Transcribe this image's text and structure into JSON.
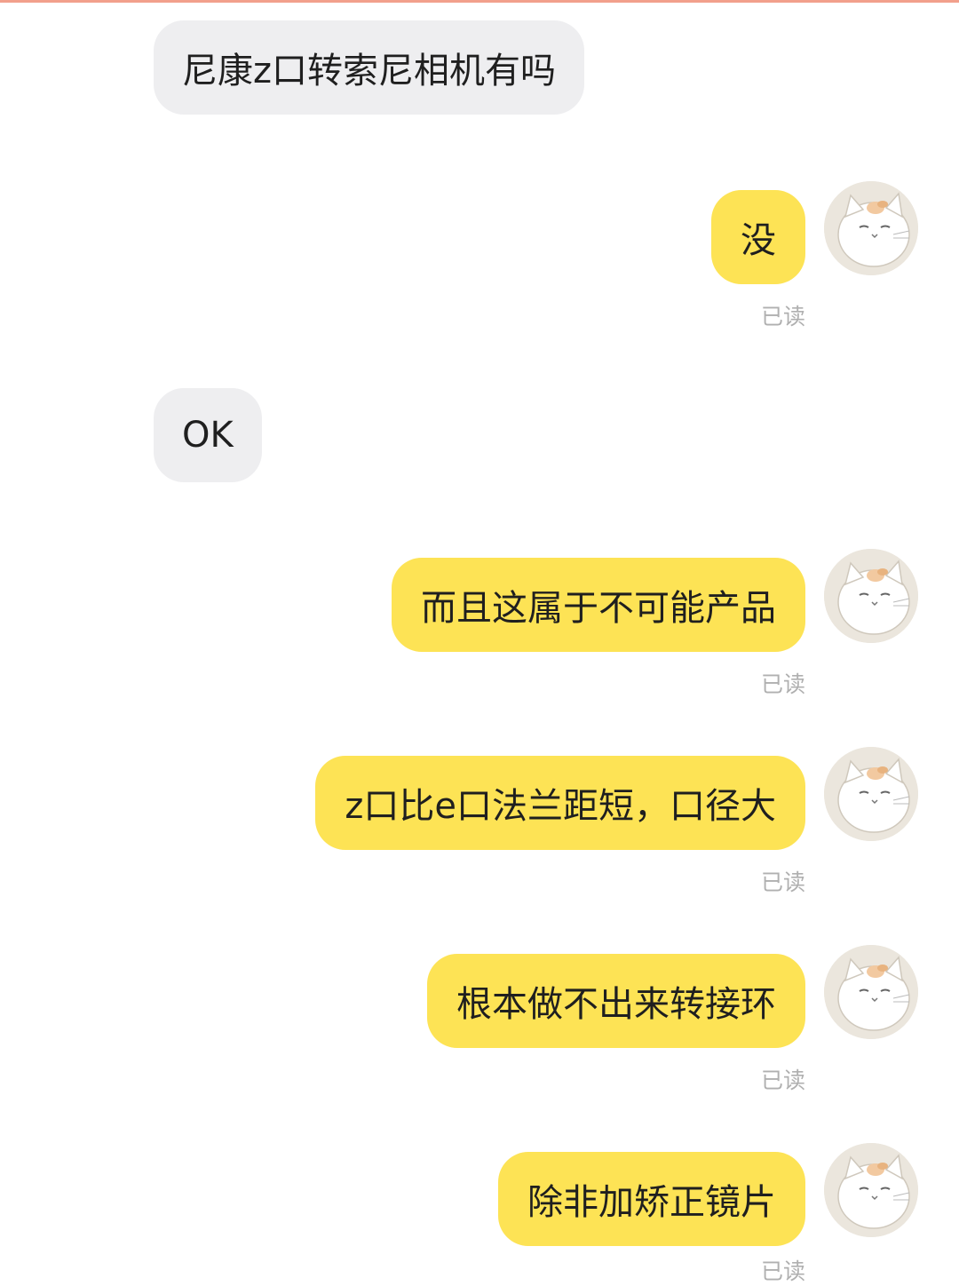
{
  "accent_colors": {
    "outgoing_bubble": "#fde355",
    "incoming_bubble": "#eeeef0",
    "read_status_text": "#b0b0b0",
    "top_line": "#f2a08c"
  },
  "messages": [
    {
      "direction": "incoming",
      "text": "尼康z口转索尼相机有吗"
    },
    {
      "direction": "outgoing",
      "text": "没",
      "status": "已读",
      "avatar_icon": "cat-avatar-icon"
    },
    {
      "direction": "incoming",
      "text": "OK"
    },
    {
      "direction": "outgoing",
      "text": "而且这属于不可能产品",
      "status": "已读",
      "avatar_icon": "cat-avatar-icon"
    },
    {
      "direction": "outgoing",
      "text": "z口比e口法兰距短，口径大",
      "status": "已读",
      "avatar_icon": "cat-avatar-icon"
    },
    {
      "direction": "outgoing",
      "text": "根本做不出来转接环",
      "status": "已读",
      "avatar_icon": "cat-avatar-icon"
    },
    {
      "direction": "outgoing",
      "text": "除非加矫正镜片",
      "status": "已读",
      "avatar_icon": "cat-avatar-icon"
    }
  ]
}
